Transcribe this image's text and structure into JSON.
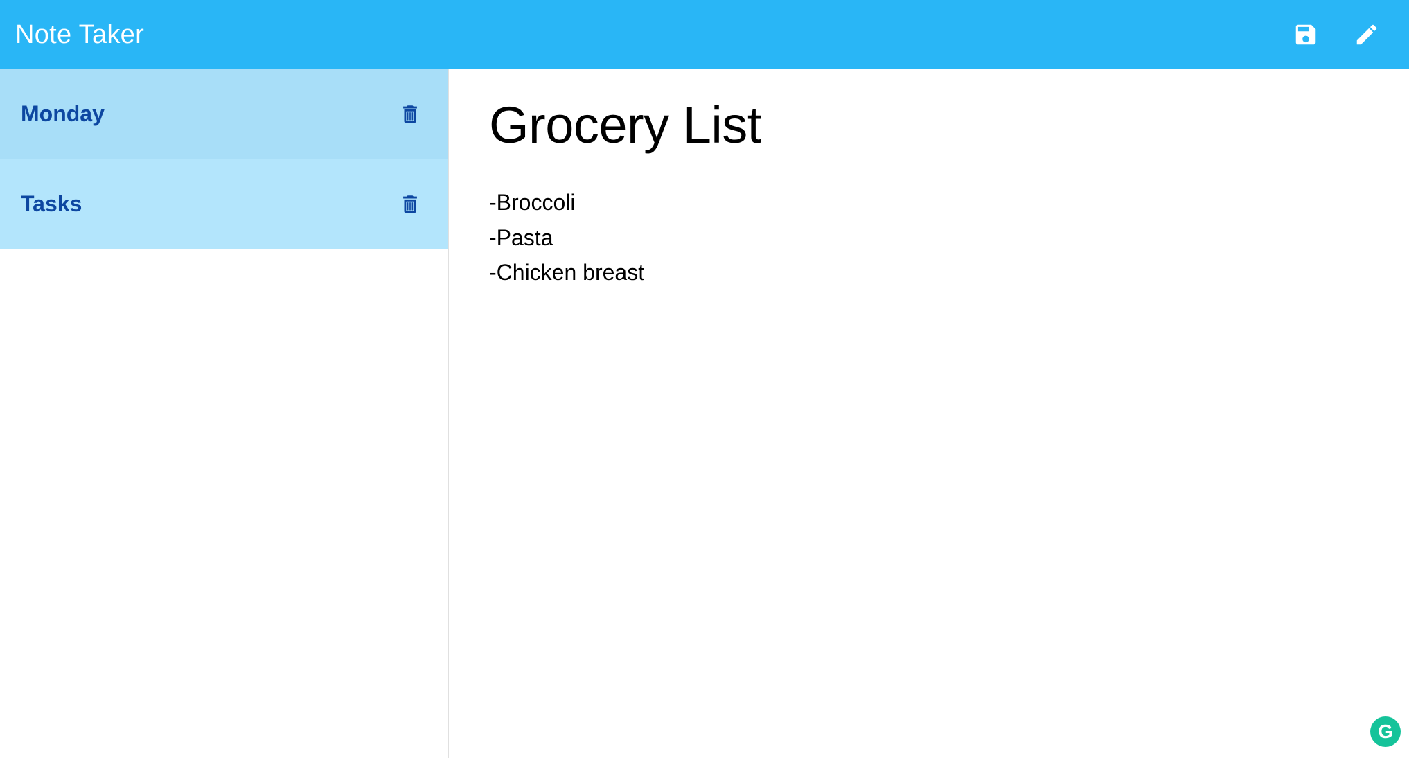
{
  "header": {
    "title": "Note Taker"
  },
  "sidebar": {
    "items": [
      {
        "label": "Monday"
      },
      {
        "label": "Tasks"
      }
    ]
  },
  "note": {
    "title": "Grocery List",
    "lines": [
      "-Broccoli",
      "-Pasta",
      "-Chicken breast"
    ]
  },
  "badge": {
    "glyph": "G"
  }
}
